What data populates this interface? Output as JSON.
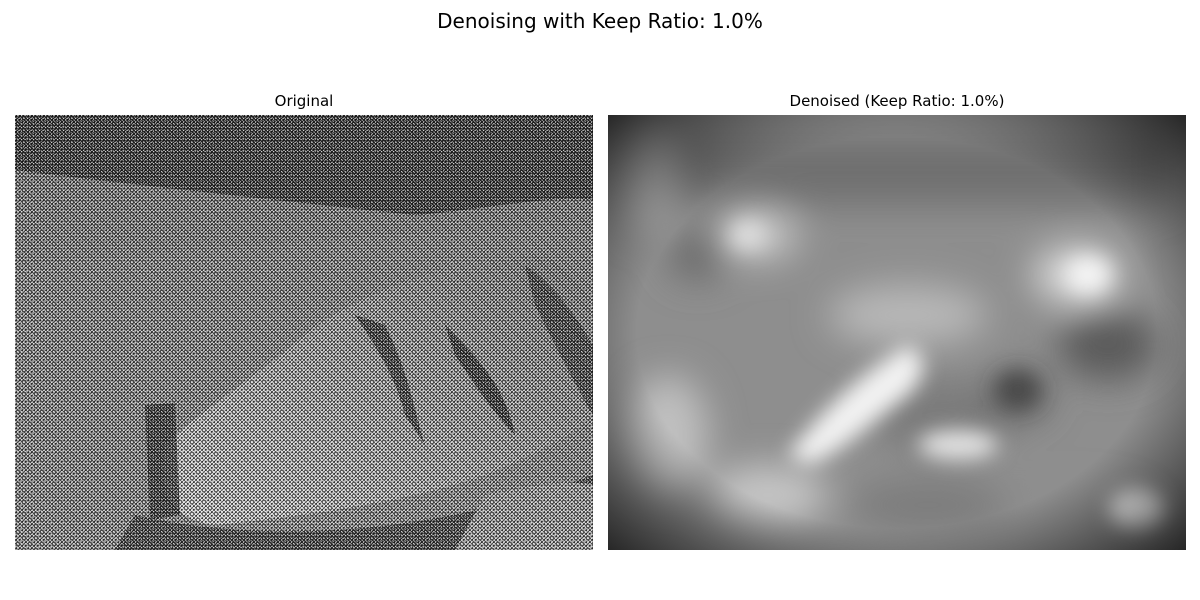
{
  "figure": {
    "title": "Denoising with Keep Ratio: 1.0%"
  },
  "panels": [
    {
      "title": "Original",
      "image": "noisy-grayscale-moon-rock-photo"
    },
    {
      "title": "Denoised (Keep Ratio: 1.0%)",
      "image": "blurred-denoised-grayscale-photo"
    }
  ],
  "colors": {
    "background": "#ffffff",
    "text": "#000000"
  }
}
